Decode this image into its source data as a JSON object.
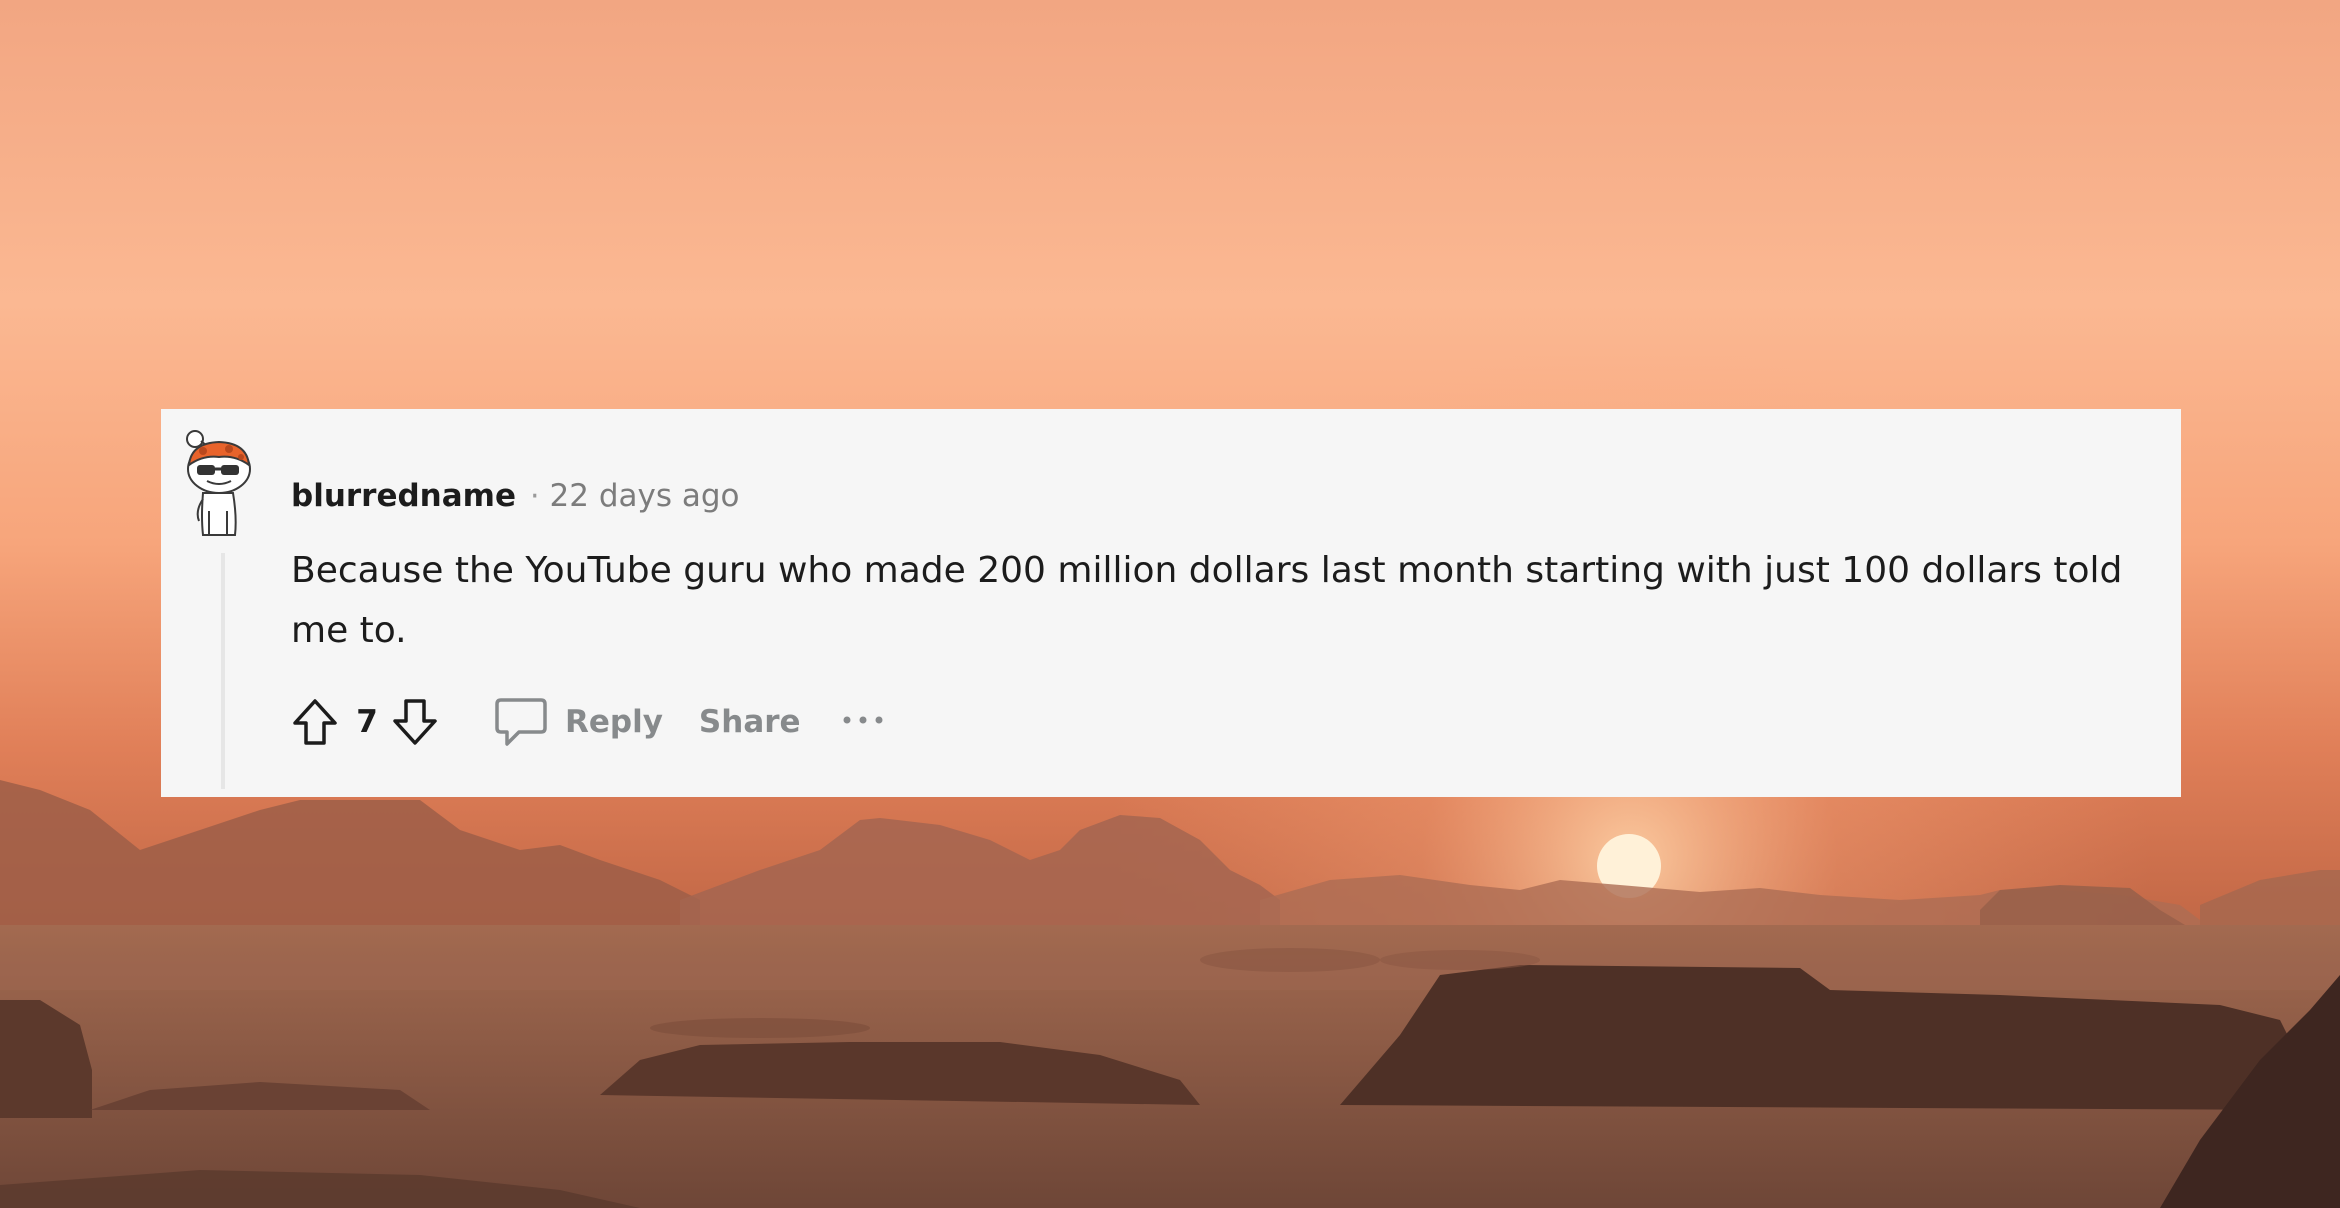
{
  "comment": {
    "author": "blurredname",
    "separator": "·",
    "timestamp": "22 days ago",
    "body": "Because the YouTube guru who made 200 million dollars last month starting with just 100 dollars told me to.",
    "score": "7"
  },
  "actions": {
    "reply_label": "Reply",
    "share_label": "Share",
    "upvote_icon": "arrow-up-icon",
    "downvote_icon": "arrow-down-icon",
    "reply_icon": "speech-bubble-icon",
    "more_icon": "ellipsis-icon"
  },
  "colors": {
    "card_background": "#f6f6f6",
    "text_primary": "#1c1c1c",
    "text_muted": "#878a8c",
    "avatar_accent": "#e8632b"
  }
}
